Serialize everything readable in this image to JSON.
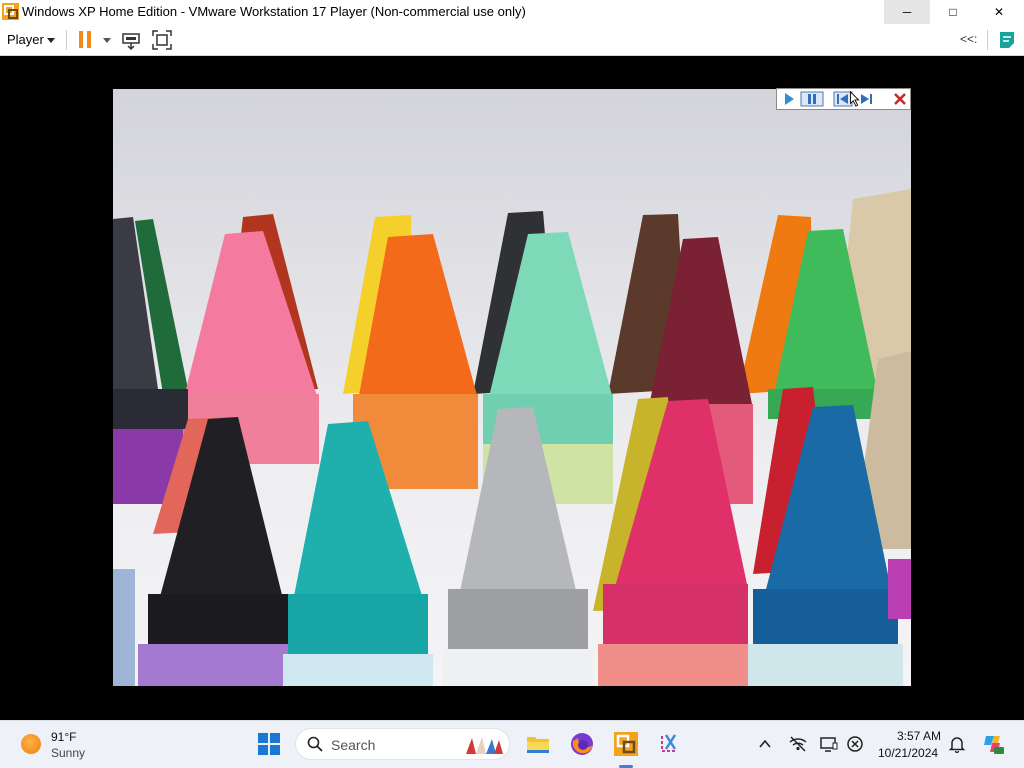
{
  "window": {
    "title": "Windows XP Home Edition - VMware Workstation 17 Player (Non-commercial use only)",
    "minimize_glyph": "─",
    "maximize_glyph": "□",
    "close_glyph": "✕"
  },
  "toolbar": {
    "player_menu_label": "Player",
    "collapse_label": "<<:",
    "icons": [
      "pause-icon",
      "send-ctrl-alt-del-icon",
      "fullscreen-icon",
      "unity-icon"
    ]
  },
  "vm_screen": {
    "content": "crayon photo slideshow",
    "slideshow_controls": [
      "play-icon",
      "pause-icon",
      "previous-icon",
      "next-icon",
      "close-icon"
    ]
  },
  "taskbar": {
    "weather": {
      "temperature": "91°F",
      "condition": "Sunny"
    },
    "search_placeholder": "Search",
    "pinned_apps": [
      "file-explorer-icon",
      "firefox-icon",
      "vmware-player-icon",
      "snipping-tool-icon"
    ],
    "tray_icons": [
      "show-hidden-icons-chevron",
      "network-icon",
      "display-icon",
      "accessibility-icon",
      "notifications-icon",
      "copilot-icon"
    ],
    "clock_time": "3:57 AM",
    "clock_date": "10/21/2024"
  },
  "colors": {
    "pause_accent": "#f08a1c",
    "taskbar_bg": "#eef2f8",
    "vm_background": "#000000"
  }
}
